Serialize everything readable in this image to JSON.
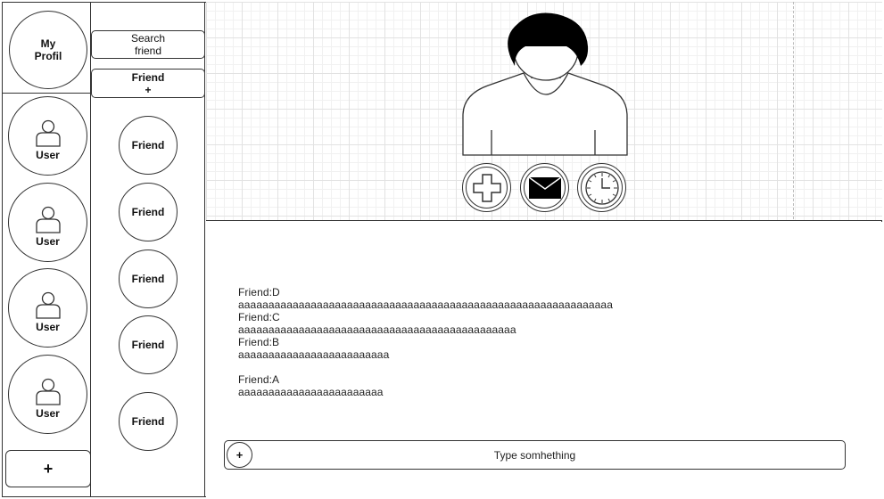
{
  "profile": {
    "label": "My Profil"
  },
  "users": [
    {
      "label": "User"
    },
    {
      "label": "User"
    },
    {
      "label": "User"
    },
    {
      "label": "User"
    }
  ],
  "add_user": {
    "label": "+"
  },
  "friends_column": {
    "search_label": "Search friend",
    "add_friend_label": "Friend +",
    "friends": [
      {
        "label": "Friend"
      },
      {
        "label": "Friend"
      },
      {
        "label": "Friend"
      },
      {
        "label": "Friend"
      },
      {
        "label": "Friend"
      }
    ]
  },
  "actions": {
    "add_icon": "plus-icon",
    "message_icon": "envelope-icon",
    "history_icon": "clock-icon"
  },
  "chat": {
    "messages": [
      {
        "sender": "Friend:D",
        "text": "aaaaaaaaaaaaaaaaaaaaaaaaaaaaaaaaaaaaaaaaaaaaaaaaaaaaaaaaaaaaaa"
      },
      {
        "sender": "Friend:C",
        "text": "aaaaaaaaaaaaaaaaaaaaaaaaaaaaaaaaaaaaaaaaaaaaaa"
      },
      {
        "sender": "Friend:B",
        "text": "aaaaaaaaaaaaaaaaaaaaaaaaa"
      },
      {
        "sender": "Friend:A",
        "text": "aaaaaaaaaaaaaaaaaaaaaaaa"
      }
    ],
    "input_placeholder": "Type somhething",
    "attach_label": "+"
  }
}
